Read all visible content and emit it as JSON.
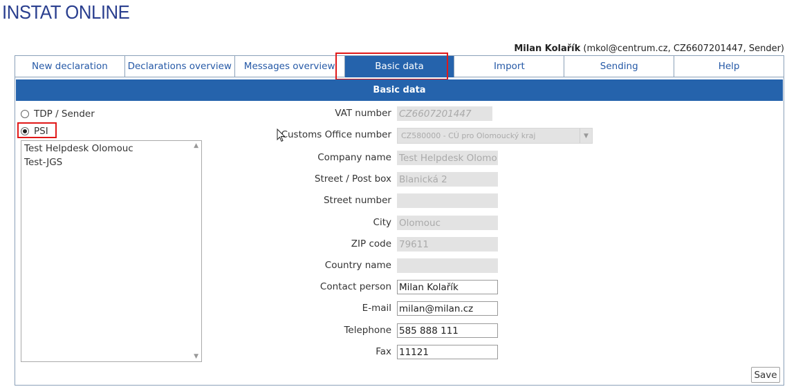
{
  "app": {
    "title": "INSTAT ONLINE"
  },
  "user": {
    "name": "Milan Kolařík",
    "details": " (mkol@centrum.cz, CZ6607201447, Sender)"
  },
  "tabs": [
    {
      "label": "New declaration",
      "active": false
    },
    {
      "label": "Declarations overview",
      "active": false
    },
    {
      "label": "Messages overview",
      "active": false
    },
    {
      "label": "Basic data",
      "active": true
    },
    {
      "label": "Import",
      "active": false
    },
    {
      "label": "Sending",
      "active": false
    },
    {
      "label": "Help",
      "active": false
    }
  ],
  "section": {
    "title": "Basic data"
  },
  "role": {
    "options": [
      {
        "label": "TDP / Sender",
        "checked": false
      },
      {
        "label": "PSI",
        "checked": true
      }
    ]
  },
  "psi_list": {
    "items": [
      "Test Helpdesk Olomouc",
      "Test-JGS"
    ]
  },
  "form": {
    "vat_number": {
      "label": "VAT number",
      "value": "CZ6607201447"
    },
    "customs_office": {
      "label": "Customs Office number",
      "value": "CZ580000 - CÚ pro Olomoucký kraj"
    },
    "company_name": {
      "label": "Company name",
      "value": "Test Helpdesk Olomouc"
    },
    "street": {
      "label": "Street / Post box",
      "value": "Blanická 2"
    },
    "street_number": {
      "label": "Street number",
      "value": ""
    },
    "city": {
      "label": "City",
      "value": "Olomouc"
    },
    "zip": {
      "label": "ZIP code",
      "value": "79611"
    },
    "country": {
      "label": "Country name",
      "value": ""
    },
    "contact_person": {
      "label": "Contact person",
      "value": "Milan Kolařík"
    },
    "email": {
      "label": "E-mail",
      "value": "milan@milan.cz"
    },
    "telephone": {
      "label": "Telephone",
      "value": "585 888 111"
    },
    "fax": {
      "label": "Fax",
      "value": "11121"
    }
  },
  "actions": {
    "save_label": "Save"
  },
  "colors": {
    "primary": "#2563ac",
    "title": "#2a3f8f",
    "highlight": "#e01818",
    "disabled_field": "#e3e3e3"
  },
  "icons": [
    "chevron-up-icon",
    "chevron-down-icon",
    "dropdown-arrow-icon",
    "mouse-pointer-icon"
  ]
}
